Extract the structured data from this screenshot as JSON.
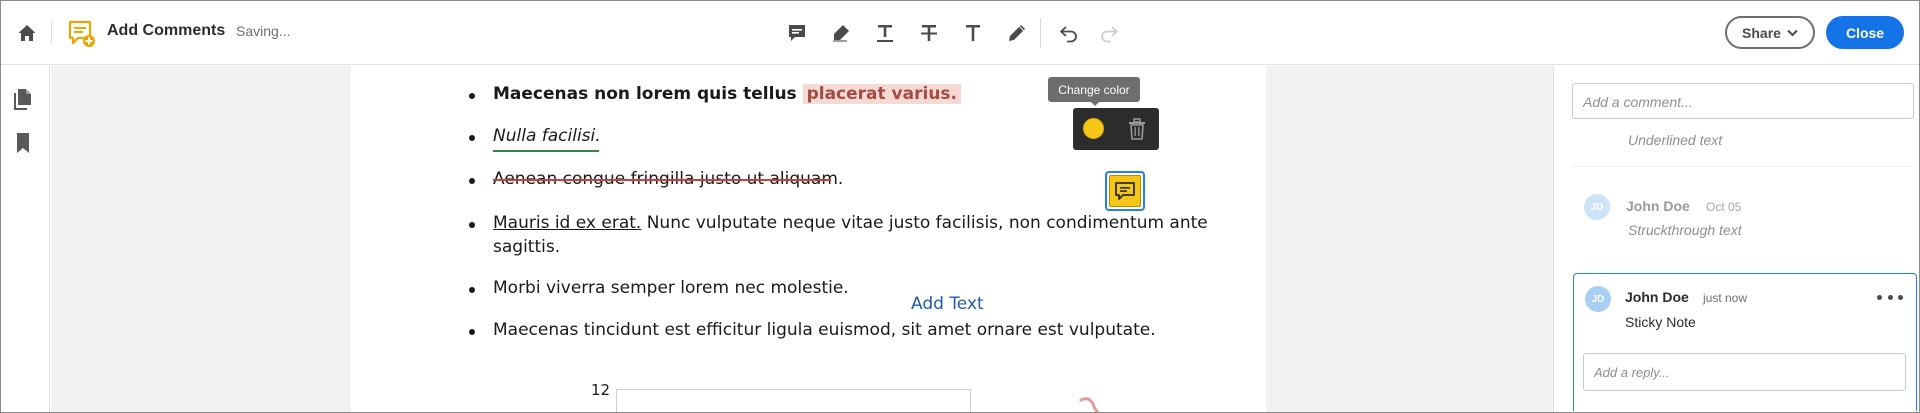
{
  "header": {
    "title": "Add Comments",
    "status": "Saving...",
    "share_label": "Share",
    "close_label": "Close",
    "icons": [
      "home-icon",
      "add-comment-icon",
      "sticky-note-icon",
      "highlight-icon",
      "underline-text-icon",
      "strikethrough-text-icon",
      "add-text-icon",
      "draw-icon",
      "undo-icon",
      "redo-icon",
      "chevron-down-icon"
    ]
  },
  "left_rail": {
    "icons": [
      "pages-icon",
      "bookmark-icon"
    ]
  },
  "document": {
    "lines": {
      "l1_bold": "Maecenas non lorem quis tellus ",
      "l1_highlight": "placerat varius.",
      "l2": "Nulla facilisi.",
      "l3": "Aenean congue fringilla justo ut aliquam.",
      "l4_underlined": "Mauris id ex erat.",
      "l4_rest": " Nunc vulputate neque vitae justo facilisis, non condimentum ante",
      "l4b": "sagittis.",
      "l5": "Morbi viverra semper lorem nec molestie.",
      "l6": "Maecenas tincidunt est efficitur ligula euismod, sit amet ornare est vulputate."
    },
    "add_text_label": "Add Text",
    "chart_tick": "12"
  },
  "popover": {
    "tooltip": "Change color",
    "color": "#f5c518",
    "icons": [
      "color-swatch-icon",
      "trash-icon"
    ]
  },
  "comments": {
    "input_placeholder": "Add a comment...",
    "items": [
      {
        "text": "Underlined text"
      },
      {
        "initials": "JD",
        "author": "John Doe",
        "date": "Oct 05",
        "text": "Struckthrough text"
      },
      {
        "initials": "JD",
        "author": "John Doe",
        "date": "just now",
        "text": "Sticky Note",
        "reply_placeholder": "Add a reply..."
      }
    ]
  },
  "colors": {
    "accent": "#1473e6",
    "highlight_bg": "#f7d9d4",
    "underline": "#2b8a3e",
    "strike": "#cc3d3d",
    "sticky": "#f5c518"
  }
}
